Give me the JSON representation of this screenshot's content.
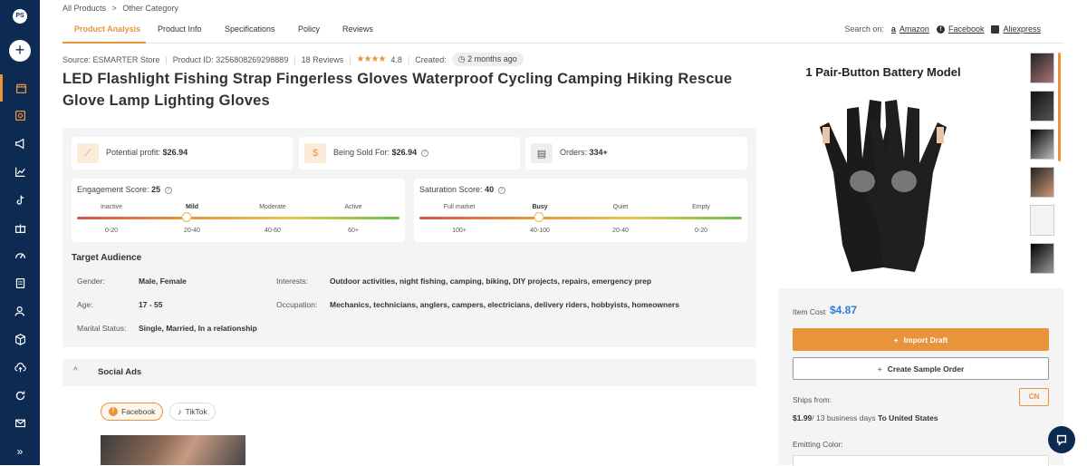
{
  "sidebar": {
    "avatar": "PS",
    "add_label": "+",
    "items": [
      "box-icon",
      "analytics-box-icon",
      "megaphone-icon",
      "chart-icon",
      "tiktok-icon",
      "gift-icon",
      "speedometer-icon",
      "document-icon",
      "users-icon",
      "package-icon",
      "cloud-upload-icon",
      "refresh-icon",
      "mail-icon",
      "expand-icon"
    ],
    "expand_label": "»"
  },
  "breadcrumb": {
    "root": "All Products",
    "sep": ">",
    "current": "Other Category"
  },
  "tabs": [
    {
      "label": "Product Analysis",
      "active": true
    },
    {
      "label": "Product Info",
      "active": false
    },
    {
      "label": "Specifications",
      "active": false
    },
    {
      "label": "Policy",
      "active": false
    },
    {
      "label": "Reviews",
      "active": false
    }
  ],
  "search_on": {
    "label": "Search on:",
    "links": [
      "Amazon",
      "Facebook",
      "Aliexpress"
    ]
  },
  "meta": {
    "source": "Source: ESMARTER Store",
    "product_id": "Product ID: 3256808269298889",
    "reviews": "18 Reviews",
    "rating": "4.8",
    "stars": "★★★★",
    "created_label": "Created:",
    "created_value": "2 months ago"
  },
  "title": "LED Flashlight Fishing Strap Fingerless Gloves Waterproof Cycling Camping Hiking Rescue Glove Lamp Lighting Gloves",
  "stats": {
    "profit_label": "Potential profit:",
    "profit_value": "$26.94",
    "sold_label": "Being Sold For:",
    "sold_value": "$26.94",
    "orders_label": "Orders:",
    "orders_value": "334+"
  },
  "engagement": {
    "label": "Engagement Score:",
    "value": "25",
    "levels": [
      "Inactive",
      "Mild",
      "Moderate",
      "Active"
    ],
    "ranges": [
      "0-20",
      "20-40",
      "40-60",
      "60+"
    ],
    "active_index": 1,
    "position": 0.34
  },
  "saturation": {
    "label": "Saturation Score:",
    "value": "40",
    "levels": [
      "Full market",
      "Busy",
      "Quiet",
      "Empty"
    ],
    "ranges": [
      "100+",
      "40-100",
      "20-40",
      "0-20"
    ],
    "active_index": 1,
    "position": 0.37
  },
  "audience": {
    "title": "Target Audience",
    "gender_label": "Gender:",
    "gender": "Male, Female",
    "age_label": "Age:",
    "age": "17 - 55",
    "marital_label": "Marital Status:",
    "marital": "Single, Married, In a relationship",
    "interests_label": "Interests:",
    "interests": "Outdoor activities, night fishing, camping, biking, DIY projects, repairs, emergency prep",
    "occupation_label": "Occupation:",
    "occupation": "Mechanics, technicians, anglers, campers, electricians, delivery riders, hobbyists, homeowners"
  },
  "social": {
    "title": "Social Ads",
    "chev": "^",
    "platforms": [
      "Facebook",
      "TikTok"
    ]
  },
  "hero_caption": "1 Pair-Button Battery Model",
  "buy": {
    "item_cost_label": "Item Cost",
    "item_cost": "$4.87",
    "import_label": "Import Draft",
    "sample_label": "Create Sample Order",
    "ships_from_label": "Ships from:",
    "ships_from_value": "CN",
    "shipping_price": "$1.99",
    "shipping_days": "/ 13 business days",
    "shipping_dest": "To United States",
    "emitting_label": "Emitting Color:"
  },
  "colors": {
    "accent": "#e8943a",
    "sidebar": "#0d2a52",
    "price": "#2f7bd9"
  }
}
